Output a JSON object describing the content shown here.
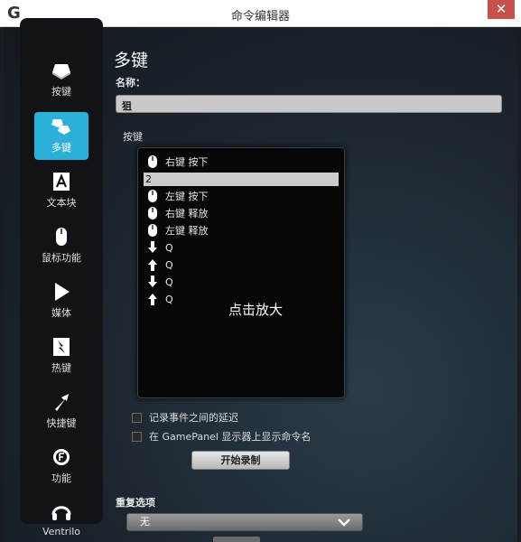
{
  "window": {
    "title": "命令编辑器",
    "close_glyph": "✕",
    "logo": "G"
  },
  "sidebar": {
    "items": [
      {
        "label": "按键",
        "icon": "key-icon",
        "active": false
      },
      {
        "label": "多键",
        "icon": "multikey-icon",
        "active": true
      },
      {
        "label": "文本块",
        "icon": "text-block-icon",
        "active": false
      },
      {
        "label": "鼠标功能",
        "icon": "mouse-icon",
        "active": false
      },
      {
        "label": "媒体",
        "icon": "media-play-icon",
        "active": false
      },
      {
        "label": "热键",
        "icon": "hotkey-icon",
        "active": false
      },
      {
        "label": "快捷键",
        "icon": "shortcut-arrow-icon",
        "active": false
      },
      {
        "label": "功能",
        "icon": "function-gear-icon",
        "active": false
      },
      {
        "label": "Ventrilo",
        "icon": "headset-icon",
        "active": false
      }
    ]
  },
  "editor": {
    "section_title": "多键",
    "name_label": "名称：",
    "name_value": "狙",
    "keys_label": "按键",
    "key_edit_value": "2",
    "key_events": [
      {
        "label": "右键 按下",
        "icon": "mouse-icon"
      },
      {
        "label": "左键 按下",
        "icon": "mouse-icon"
      },
      {
        "label": "右键 释放",
        "icon": "mouse-icon"
      },
      {
        "label": "左键 释放",
        "icon": "mouse-icon"
      },
      {
        "label": "Q",
        "icon": "key-down-arrow-icon"
      },
      {
        "label": "Q",
        "icon": "key-up-arrow-icon"
      },
      {
        "label": "Q",
        "icon": "key-down-arrow-icon"
      },
      {
        "label": "Q",
        "icon": "key-up-arrow-icon"
      }
    ],
    "zoom_hint": "点击放大",
    "record_delay_label": "记录事件之间的延迟",
    "gamepanel_label": "在 GamePanel 显示器上显示命令名",
    "record_button": "开始录制",
    "repeat_label": "重复选项",
    "repeat_value": "无"
  },
  "colors": {
    "accent": "#2cb0d9",
    "close": "#c7504a"
  }
}
